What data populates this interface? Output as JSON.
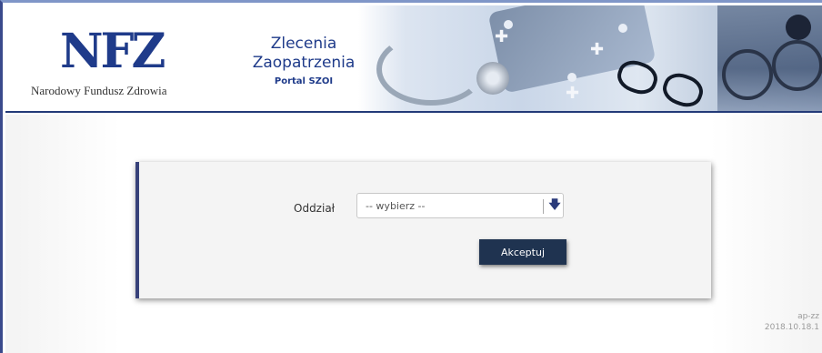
{
  "header": {
    "logo_text": "NFZ",
    "logo_subtitle": "Narodowy Fundusz Zdrowia",
    "title_line1": "Zlecenia",
    "title_line2": "Zaopatrzenia",
    "portal_name": "Portal SZOI"
  },
  "form": {
    "oddzial_label": "Oddział",
    "oddzial_select": {
      "selected": "-- wybierz --",
      "icon": "arrow-down-icon"
    },
    "accept_label": "Akceptuj"
  },
  "footer": {
    "app_code": "ap-zz",
    "version": "2018.10.18.1"
  },
  "colors": {
    "brand_blue": "#1f3b8a",
    "button_bg": "#1f3350",
    "card_accent": "#38427a"
  }
}
